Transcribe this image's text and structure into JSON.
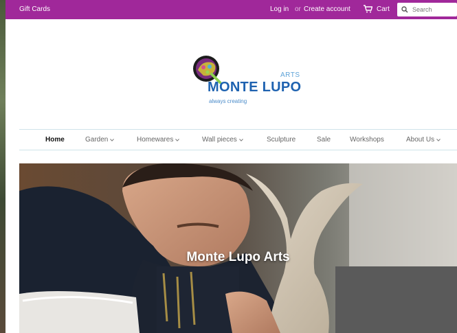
{
  "topbar": {
    "gift_cards": "Gift Cards",
    "login": "Log in",
    "or": "or",
    "create_account": "Create account",
    "cart": "Cart",
    "search_placeholder": "Search"
  },
  "logo": {
    "arts": "ARTS",
    "name": "MONTE LUPO",
    "tagline": "always creating"
  },
  "nav": {
    "items": [
      {
        "label": "Home",
        "dropdown": false
      },
      {
        "label": "Garden",
        "dropdown": true
      },
      {
        "label": "Homewares",
        "dropdown": true
      },
      {
        "label": "Wall pieces",
        "dropdown": true
      },
      {
        "label": "Sculpture",
        "dropdown": false
      },
      {
        "label": "Sale",
        "dropdown": false
      },
      {
        "label": "Workshops",
        "dropdown": false
      },
      {
        "label": "About Us",
        "dropdown": true
      }
    ]
  },
  "hero": {
    "title": "Monte Lupo Arts"
  },
  "colors": {
    "topbar": "#a0289a",
    "brand_blue": "#1e62b0",
    "nav_line": "#cfe3ea"
  }
}
